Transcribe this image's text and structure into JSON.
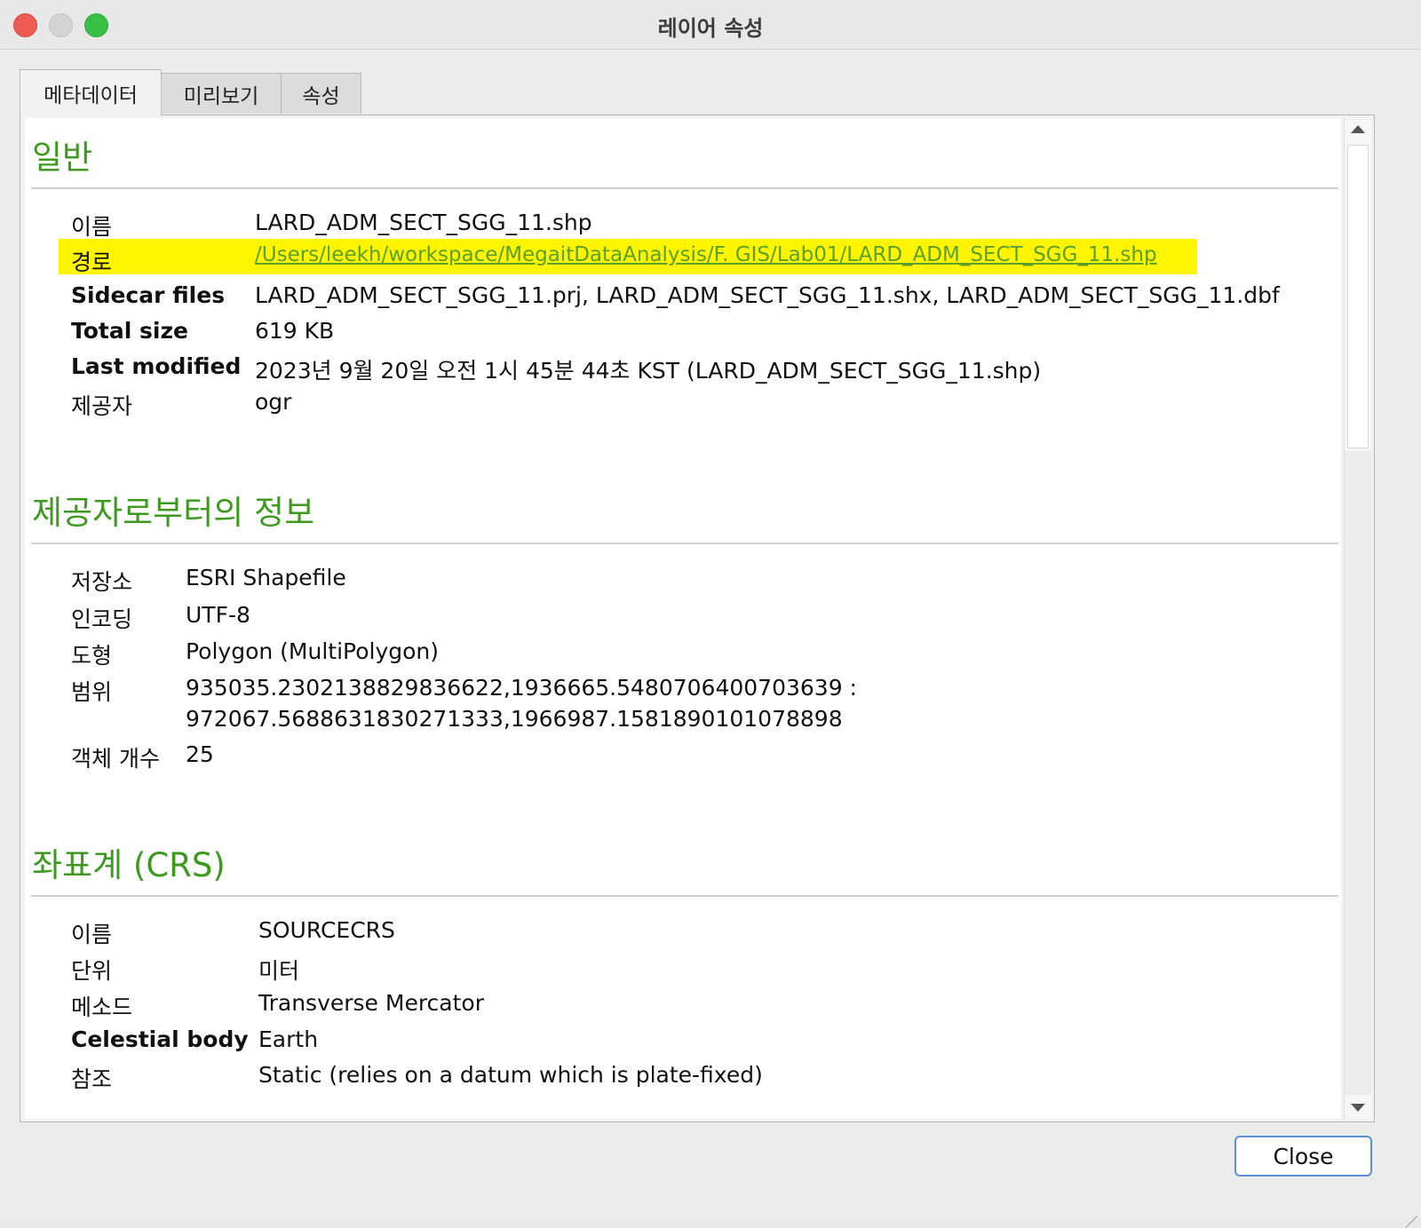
{
  "window": {
    "title": "레이어 속성"
  },
  "tabs": [
    {
      "label": "메타데이터"
    },
    {
      "label": "미리보기"
    },
    {
      "label": "속성"
    }
  ],
  "general": {
    "title": "일반",
    "rows": [
      {
        "label": "이름",
        "value": "LARD_ADM_SECT_SGG_11.shp"
      },
      {
        "label": "경로",
        "value": "/Users/leekh/workspace/MegaitDataAnalysis/F. GIS/Lab01/LARD_ADM_SECT_SGG_11.shp"
      },
      {
        "label": "Sidecar files",
        "value": "LARD_ADM_SECT_SGG_11.prj, LARD_ADM_SECT_SGG_11.shx, LARD_ADM_SECT_SGG_11.dbf"
      },
      {
        "label": "Total size",
        "value": "619 KB"
      },
      {
        "label": "Last modified",
        "value": "2023년 9월 20일 오전 1시 45분 44초 KST (LARD_ADM_SECT_SGG_11.shp)"
      },
      {
        "label": "제공자",
        "value": "ogr"
      }
    ]
  },
  "provider": {
    "title": "제공자로부터의 정보",
    "rows": [
      {
        "label": "저장소",
        "value": "ESRI Shapefile"
      },
      {
        "label": "인코딩",
        "value": "UTF-8"
      },
      {
        "label": "도형",
        "value": "Polygon (MultiPolygon)"
      },
      {
        "label": "범위",
        "value": "935035.2302138829836622,1936665.5480706400703639 :",
        "value2": "972067.5688631830271333,1966987.1581890101078898"
      },
      {
        "label": "객체 개수",
        "value": "25"
      }
    ]
  },
  "crs": {
    "title": "좌표계 (CRS)",
    "rows": [
      {
        "label": "이름",
        "value": "SOURCECRS"
      },
      {
        "label": "단위",
        "value": "미터"
      },
      {
        "label": "메소드",
        "value": "Transverse Mercator"
      },
      {
        "label": "Celestial body",
        "value": "Earth"
      },
      {
        "label": "참조",
        "value": "Static (relies on a datum which is plate-fixed)"
      }
    ]
  },
  "buttons": {
    "close": "Close"
  }
}
